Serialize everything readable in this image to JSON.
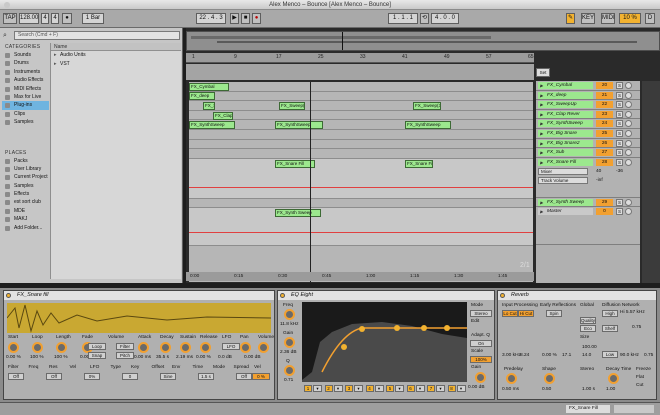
{
  "window": {
    "title": "Alex Menco – Bounce  [Alex Menco – Bounce]"
  },
  "transport": {
    "tap": "TAP",
    "tempo": "128.00",
    "sig_num": "4",
    "sig_den": "4",
    "quant": "1 Bar",
    "position": "22 . 4 . 3",
    "loop_start": "1 . 1 . 1",
    "loop_len": "4 . 0 . 0",
    "key": "KEY",
    "midi": "MIDI",
    "cpu": "10 %",
    "cpu_label": "D"
  },
  "browser": {
    "search_placeholder": "Search (Cmd + F)",
    "categories_title": "CATEGORIES",
    "categories": [
      "Sounds",
      "Drums",
      "Instruments",
      "Audio Effects",
      "MIDI Effects",
      "Max for Live",
      "Plug-ins",
      "Clips",
      "Samples"
    ],
    "selected_category": "Plug-ins",
    "places_title": "PLACES",
    "places": [
      "Packs",
      "User Library",
      "Current Project",
      "Samples",
      "Effects",
      "est sort club",
      "MDE",
      "MAKJ",
      "Add Folder..."
    ],
    "column_name": "Name",
    "items": [
      "Audio Units",
      "VST"
    ]
  },
  "ruler": {
    "bars": [
      "1",
      "9",
      "17",
      "25",
      "33",
      "41",
      "49",
      "57",
      "65"
    ],
    "timeline": [
      "0:00",
      "0:15",
      "0:30",
      "0:45",
      "1:00",
      "1:15",
      "1:30",
      "1:45"
    ],
    "page": "2/1",
    "set_label": "Set"
  },
  "arrangement": {
    "clips": [
      {
        "lane": 0,
        "label": "FX_Cymbal"
      },
      {
        "lane": 1,
        "label": "FX_deep"
      },
      {
        "lane": 2,
        "label": "FX_Sweep(1)"
      },
      {
        "lane": 2,
        "label": "FX_Sweep(2)"
      },
      {
        "lane": 2,
        "label": "FX_Sweep(3)"
      },
      {
        "lane": 3,
        "label": "FX_Clap"
      },
      {
        "lane": 4,
        "label": "FX_SynthSweep"
      },
      {
        "lane": 4,
        "label": "FX_SynthSweep"
      },
      {
        "lane": 4,
        "label": "FX_SynthSweep"
      },
      {
        "lane": 9,
        "label": "FX_Snare Fill"
      },
      {
        "lane": 9,
        "label": "FX_Snare Fill"
      },
      {
        "lane": 11,
        "label": "FX_Synth Sweep"
      }
    ]
  },
  "tracks": [
    {
      "name": "FX_Cymbal",
      "num": "20"
    },
    {
      "name": "FX_deep",
      "num": "21"
    },
    {
      "name": "FX_SweepUp",
      "num": "22"
    },
    {
      "name": "FX_Clap Rever",
      "num": "23"
    },
    {
      "name": "FX_SynthSweep",
      "num": "24"
    },
    {
      "name": "FX_Big Snare",
      "num": "25"
    },
    {
      "name": "FX_Big Snare2",
      "num": "26"
    },
    {
      "name": "FX_Sub",
      "num": "27"
    },
    {
      "name": "FX_Snare Fill",
      "num": "28",
      "sel1": "Mixer",
      "sel2": "Track Volume",
      "v1": "40",
      "v2": "-36",
      "v3": "-inf"
    },
    {
      "name": "FX_Synth Sweep",
      "num": "29",
      "sel1": "Mixer",
      "sel2": "Track Volume",
      "v1": "50.5",
      "v2": "C",
      "v3": "-inf"
    },
    {
      "name": "Master",
      "num": "0"
    }
  ],
  "simpler": {
    "title": "FX_Snare fill",
    "labels": [
      "Start",
      "Loop",
      "Length",
      "Fade",
      "Volume",
      "Attack",
      "Decay",
      "Sustain",
      "Release",
      "LFO",
      "Pan",
      "Volume"
    ],
    "values": [
      "0.00 %",
      "100 %",
      "100 %",
      "0.00 %",
      "0.00 ms",
      "35.5 s",
      "2.19 ms",
      "0.00 %",
      "0.0 dB",
      "0.00 dB"
    ],
    "buttons": [
      "Loop",
      "Snap",
      "Filter",
      "Pitch",
      "LFO"
    ],
    "bottom_labels": [
      "Filter",
      "Freq",
      "Res",
      "Vel",
      "LFO",
      "Type",
      "Key",
      "Offset",
      "Env",
      "Time",
      "Mode",
      "Spread",
      "Vel"
    ],
    "bottom_values": [
      "Off",
      "Off",
      "0%",
      "0",
      "Sine",
      "1.5 s",
      "Off"
    ],
    "env_value": "0 %"
  },
  "eq": {
    "title": "EQ Eight",
    "freq_label": "Freq",
    "freq_value": "11.8 kHz",
    "gain_label": "Gain",
    "gain_value": "2.36 dB",
    "q_label": "Q",
    "q_value": "0.71",
    "mode_label": "Mode",
    "mode_value": "Stereo",
    "edit_label": "Edit",
    "adapt_label": "Adapt. Q",
    "adapt_value": "On",
    "scale_label": "Scale",
    "scale_value": "100%",
    "gain2_label": "Gain",
    "gain2_value": "0.00 dB",
    "band_numbers": [
      "1",
      "2",
      "3",
      "4",
      "5",
      "6",
      "7",
      "8"
    ]
  },
  "reverb": {
    "title": "Reverb",
    "sections": [
      "Input Processing",
      "Early Reflections",
      "Global",
      "Diffusion Network"
    ],
    "buttons": [
      "Lo Cut",
      "Hi Cut",
      "Spin",
      "Quality",
      "Eco",
      "High",
      "Shelf",
      "Low"
    ],
    "values": [
      "3.00 kHz",
      "8.24",
      "0.00 %",
      "17.1",
      "14.0",
      "Hi 5.57 kHz",
      "90.0 kHz",
      "0.75",
      "0.75"
    ],
    "knob_labels": [
      "Predelay",
      "Shape",
      "Size",
      "Stereo",
      "Decay Time",
      "Freeze",
      "Flat",
      "Cut"
    ],
    "knob_values": [
      "0.50 ms",
      "0.50",
      "100.00",
      "1.00 s",
      "1.00"
    ]
  },
  "status": {
    "track_name": "FX_Snare Fill"
  }
}
